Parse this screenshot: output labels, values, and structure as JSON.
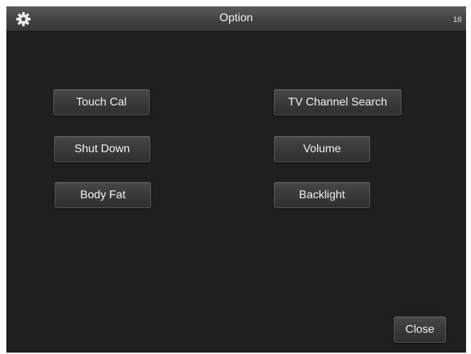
{
  "window": {
    "title": "Option",
    "counter": "16",
    "settings_icon": "gear-icon"
  },
  "buttons": {
    "touch_cal": "Touch Cal",
    "shut_down": "Shut Down",
    "body_fat": "Body Fat",
    "tv_channel_search": "TV Channel Search",
    "volume": "Volume",
    "backlight": "Backlight",
    "close": "Close"
  },
  "colors": {
    "background": "#1f1f1f",
    "title_bar": "#454545",
    "button": "#3a3a3a",
    "text": "#f2f2f2"
  }
}
